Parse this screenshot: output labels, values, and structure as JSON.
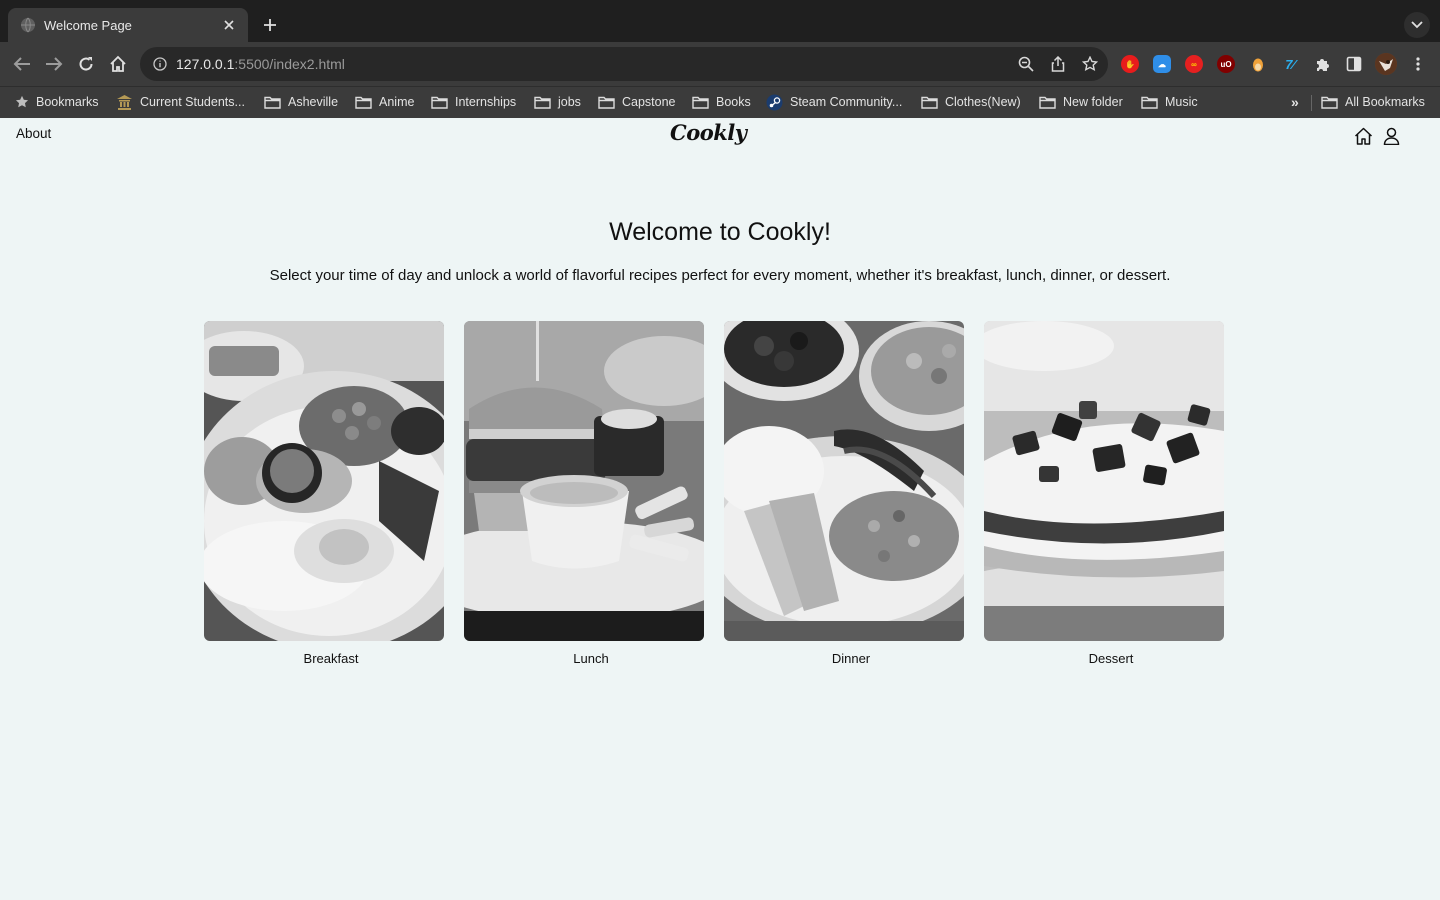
{
  "browser": {
    "tab": {
      "title": "Welcome Page"
    },
    "url": {
      "host": "127.0.0.1",
      "rest": ":5500/index2.html"
    },
    "bookmarks": [
      {
        "label": "Bookmarks",
        "icon": "star-icon"
      },
      {
        "label": "Current Students...",
        "icon": "college-icon"
      },
      {
        "label": "Asheville",
        "icon": "folder-icon"
      },
      {
        "label": "Anime",
        "icon": "folder-icon"
      },
      {
        "label": "Internships",
        "icon": "folder-icon"
      },
      {
        "label": "jobs",
        "icon": "folder-icon"
      },
      {
        "label": "Capstone",
        "icon": "folder-icon"
      },
      {
        "label": "Books",
        "icon": "folder-icon"
      },
      {
        "label": "Steam Community...",
        "icon": "steam-icon"
      },
      {
        "label": "Clothes(New)",
        "icon": "folder-icon"
      },
      {
        "label": "New folder",
        "icon": "folder-icon"
      },
      {
        "label": "Music",
        "icon": "folder-icon"
      }
    ],
    "overflow_label": "»",
    "all_bookmarks": "All Bookmarks"
  },
  "site": {
    "nav": {
      "about": "About",
      "logo": "Cookly"
    },
    "heading": "Welcome to Cookly!",
    "subheading": "Select your time of day and unlock a world of flavorful recipes perfect for every moment, whether it's breakfast, lunch, dinner, or dessert.",
    "meals": [
      {
        "label": "Breakfast"
      },
      {
        "label": "Lunch"
      },
      {
        "label": "Dinner"
      },
      {
        "label": "Dessert"
      }
    ]
  },
  "colors": {
    "page_bg": "#eef5f5",
    "chrome_dark": "#1f1f1f",
    "chrome": "#3b3b3b",
    "omnibox": "#282828"
  }
}
